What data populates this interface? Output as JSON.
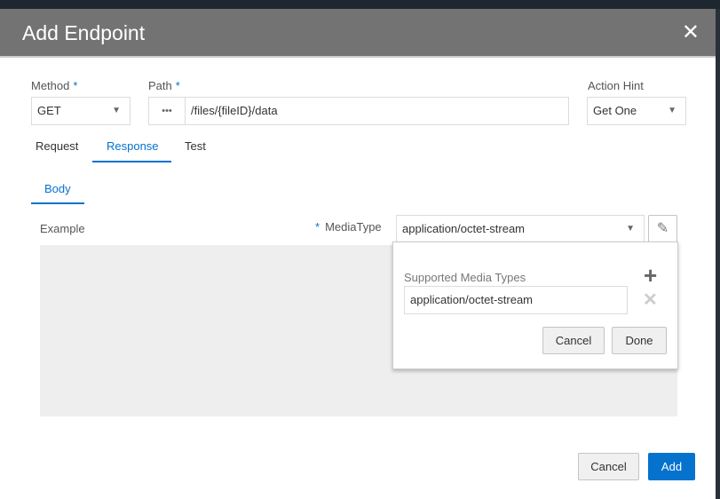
{
  "dialog": {
    "title": "Add Endpoint",
    "close_icon": "close-icon"
  },
  "form": {
    "method": {
      "label": "Method",
      "required": "*",
      "value": "GET"
    },
    "path": {
      "label": "Path",
      "required": "*",
      "value": "/files/{fileID}/data",
      "more_label": "•••"
    },
    "action_hint": {
      "label": "Action Hint",
      "value": "Get One"
    }
  },
  "tabs": [
    {
      "label": "Request"
    },
    {
      "label": "Response",
      "active": true
    },
    {
      "label": "Test"
    }
  ],
  "subtabs": [
    {
      "label": "Body",
      "active": true
    }
  ],
  "body": {
    "example_label": "Example",
    "media_required": "*",
    "media_label": "MediaType",
    "media_value": "application/octet-stream"
  },
  "popup": {
    "title": "Supported Media Types",
    "item_value": "application/octet-stream",
    "cancel": "Cancel",
    "done": "Done"
  },
  "footer": {
    "cancel": "Cancel",
    "add": "Add"
  },
  "colors": {
    "accent": "#0572ce",
    "header": "#737373"
  }
}
